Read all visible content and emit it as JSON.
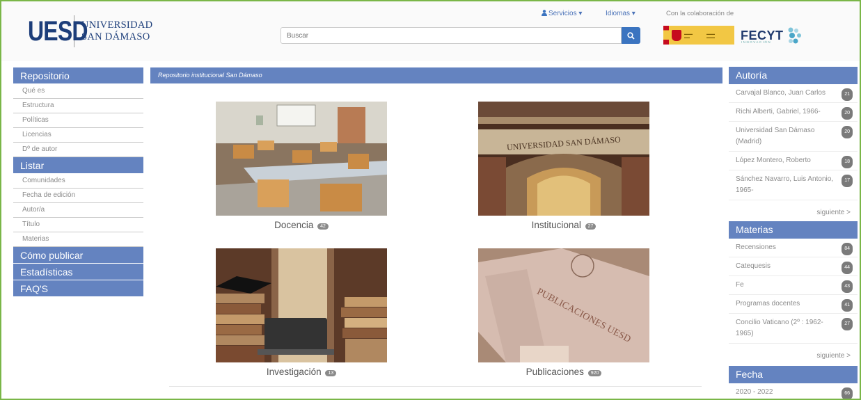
{
  "header": {
    "logo_mark": "UESD",
    "logo_line1": "UNIVERSIDAD",
    "logo_line2": "SAN DÁMASO",
    "servicios": "Servicios ▾",
    "idiomas": "Idiomas ▾",
    "colaboracion": "Con la colaboración de",
    "search_placeholder": "Buscar",
    "fecyt": "FECYT",
    "fecyt_sub": "INNOVACIÓN"
  },
  "sidebar": {
    "sections": [
      {
        "title": "Repositorio",
        "items": [
          "Qué es",
          "Estructura",
          "Políticas",
          "Licencias",
          "Dº de autor"
        ]
      },
      {
        "title": "Listar",
        "items": [
          "Comunidades",
          "Fecha de edición",
          "Autor/a",
          "Título",
          "Materias"
        ]
      },
      {
        "title": "Cómo publicar",
        "items": []
      },
      {
        "title": "Estadísticas",
        "items": []
      },
      {
        "title": "FAQ'S",
        "items": []
      }
    ]
  },
  "breadcrumb": "Repositorio institucional San Dámaso",
  "tiles": [
    {
      "label": "Docencia",
      "count": "42",
      "image_text": ""
    },
    {
      "label": "Institucional",
      "count": "27",
      "image_text": "UNIVERSIDAD SAN DÁMASO"
    },
    {
      "label": "Investigación",
      "count": "13",
      "image_text": ""
    },
    {
      "label": "Publicaciones",
      "count": "920",
      "image_text": "PUBLICACIONES UESD"
    }
  ],
  "autoria": {
    "title": "Autoría",
    "items": [
      {
        "label": "Carvajal Blanco, Juan Carlos",
        "count": "21"
      },
      {
        "label": "Richi Alberti, Gabriel, 1966-",
        "count": "20"
      },
      {
        "label": "Universidad San Dámaso (Madrid)",
        "count": "20"
      },
      {
        "label": "López Montero, Roberto",
        "count": "18"
      },
      {
        "label": "Sánchez Navarro, Luis Antonio, 1965-",
        "count": "17"
      }
    ],
    "more": "siguiente >"
  },
  "materias": {
    "title": "Materias",
    "items": [
      {
        "label": "Recensiones",
        "count": "84"
      },
      {
        "label": "Catequesis",
        "count": "44"
      },
      {
        "label": "Fe",
        "count": "43"
      },
      {
        "label": "Programas docentes",
        "count": "41"
      },
      {
        "label": "Concilio Vaticano (2º : 1962-1965)",
        "count": "27"
      }
    ],
    "more": "siguiente >"
  },
  "fecha": {
    "title": "Fecha",
    "items": [
      {
        "label": "2020 - 2022",
        "count": "66"
      }
    ]
  }
}
